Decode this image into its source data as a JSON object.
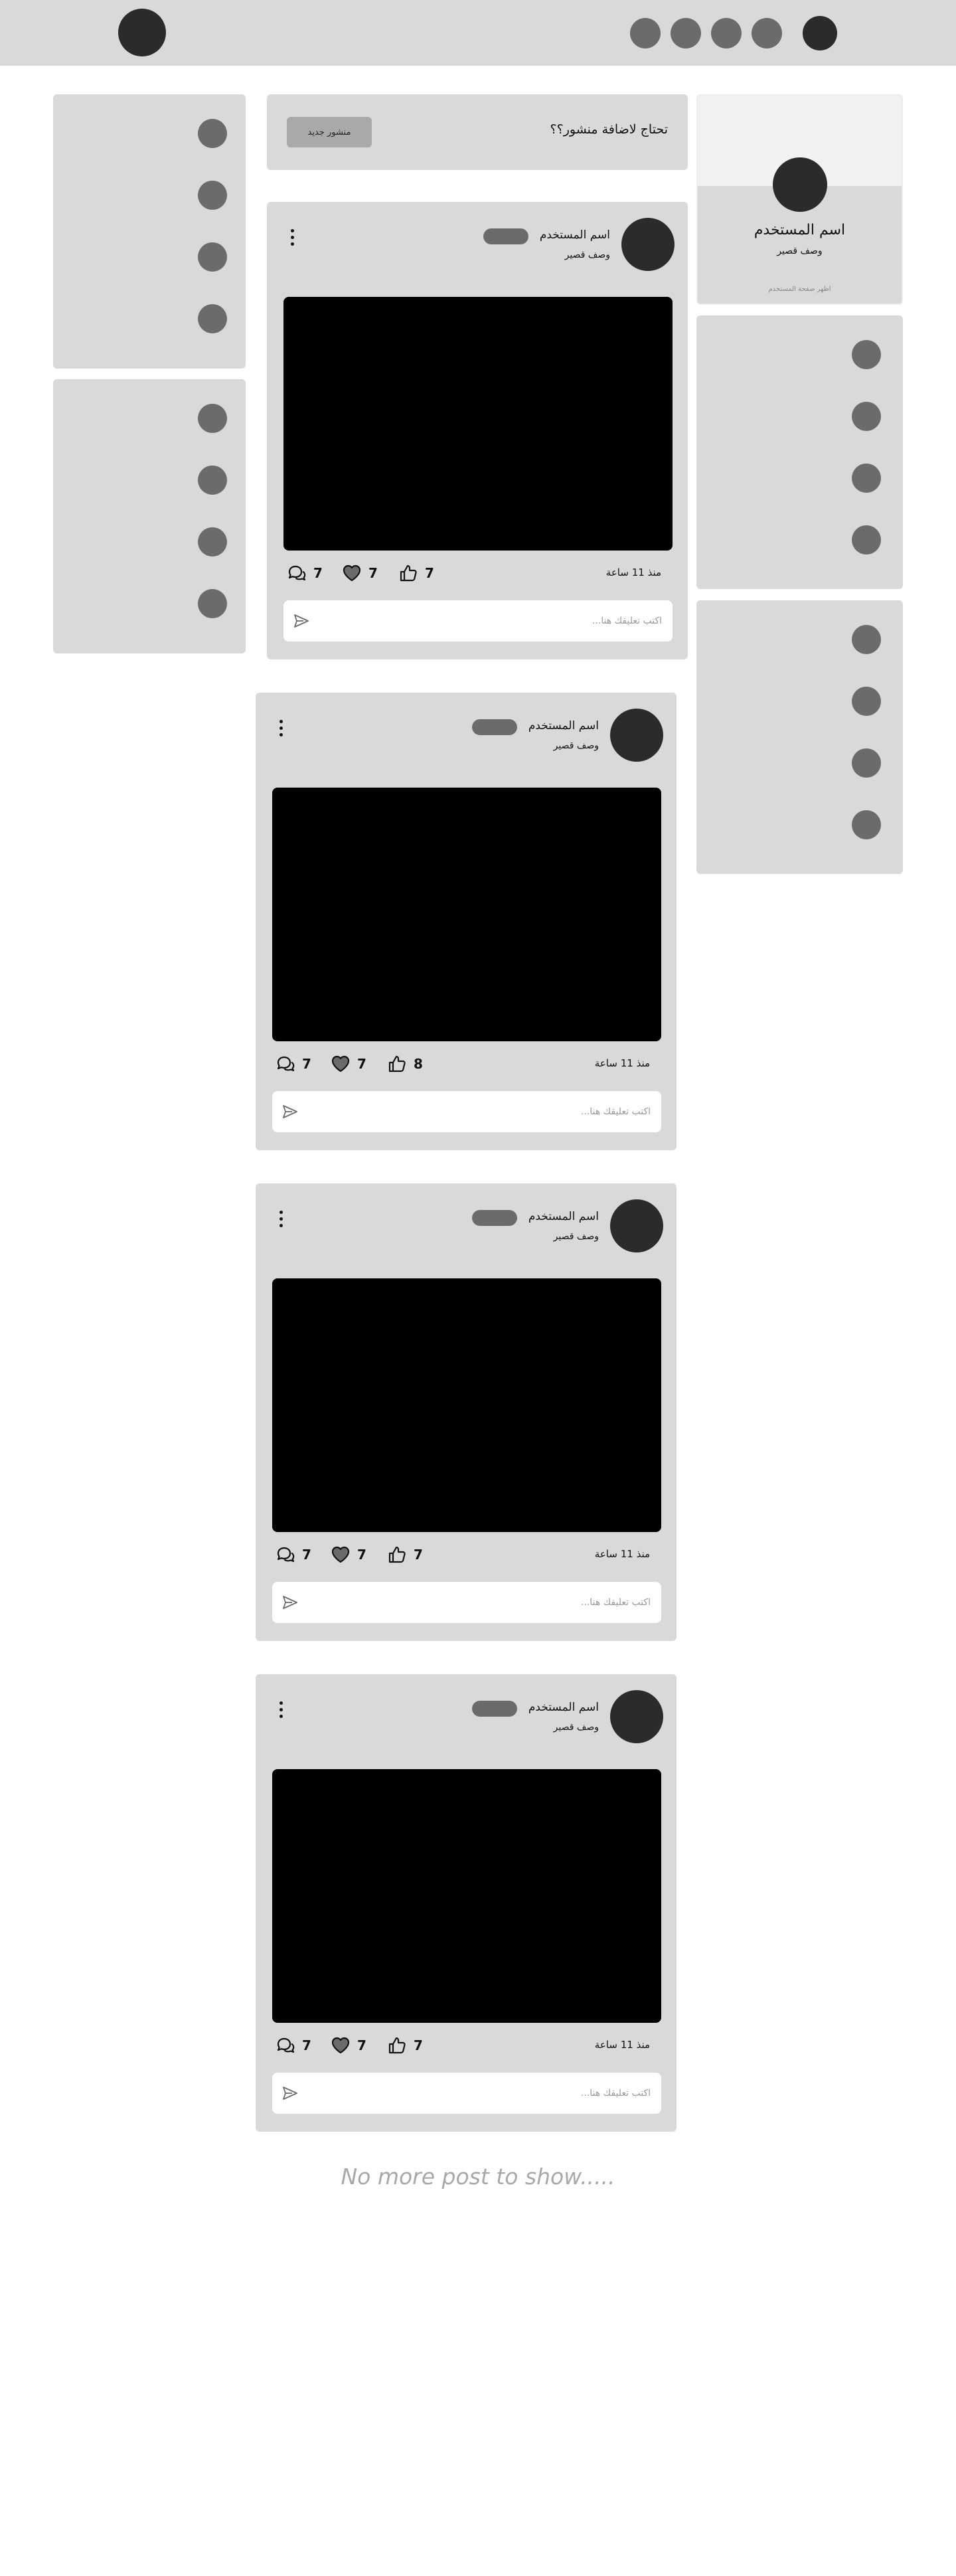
{
  "header": {
    "logo_icon": "avatar-circle",
    "nav_icons": [
      "nav-icon-1",
      "nav-icon-2",
      "nav-icon-3",
      "nav-icon-4"
    ],
    "user_icon": "user-avatar"
  },
  "profile": {
    "name": "اسم المستخدم",
    "description": "وصف قصير",
    "link": "اظهر صفحة المستخدم"
  },
  "composer": {
    "prompt": "تحتاج لاضافة منشور؟؟",
    "button_label": "منشور جديد"
  },
  "posts": [
    {
      "username": "اسم المستخدم",
      "description": "وصف قصير",
      "time": "منذ 11 ساعة",
      "likes": "7",
      "hearts": "7",
      "comments": "7",
      "comment_placeholder": "اكتب تعليقك هنا..."
    },
    {
      "username": "اسم المستخدم",
      "description": "وصف قصير",
      "time": "منذ 11 ساعة",
      "likes": "8",
      "hearts": "7",
      "comments": "7",
      "comment_placeholder": "اكتب تعليقك هنا..."
    },
    {
      "username": "اسم المستخدم",
      "description": "وصف قصير",
      "time": "منذ 11 ساعة",
      "likes": "7",
      "hearts": "7",
      "comments": "7",
      "comment_placeholder": "اكتب تعليقك هنا..."
    },
    {
      "username": "اسم المستخدم",
      "description": "وصف قصير",
      "time": "منذ 11 ساعة",
      "likes": "7",
      "hearts": "7",
      "comments": "7",
      "comment_placeholder": "اكتب تعليقك هنا..."
    }
  ],
  "feed_end_text": "No more post to show.....",
  "colors": {
    "panel": "#d9d9d9",
    "dark": "#2b2b2b",
    "placeholder_dot": "#6b6b6b",
    "media": "#000000"
  }
}
